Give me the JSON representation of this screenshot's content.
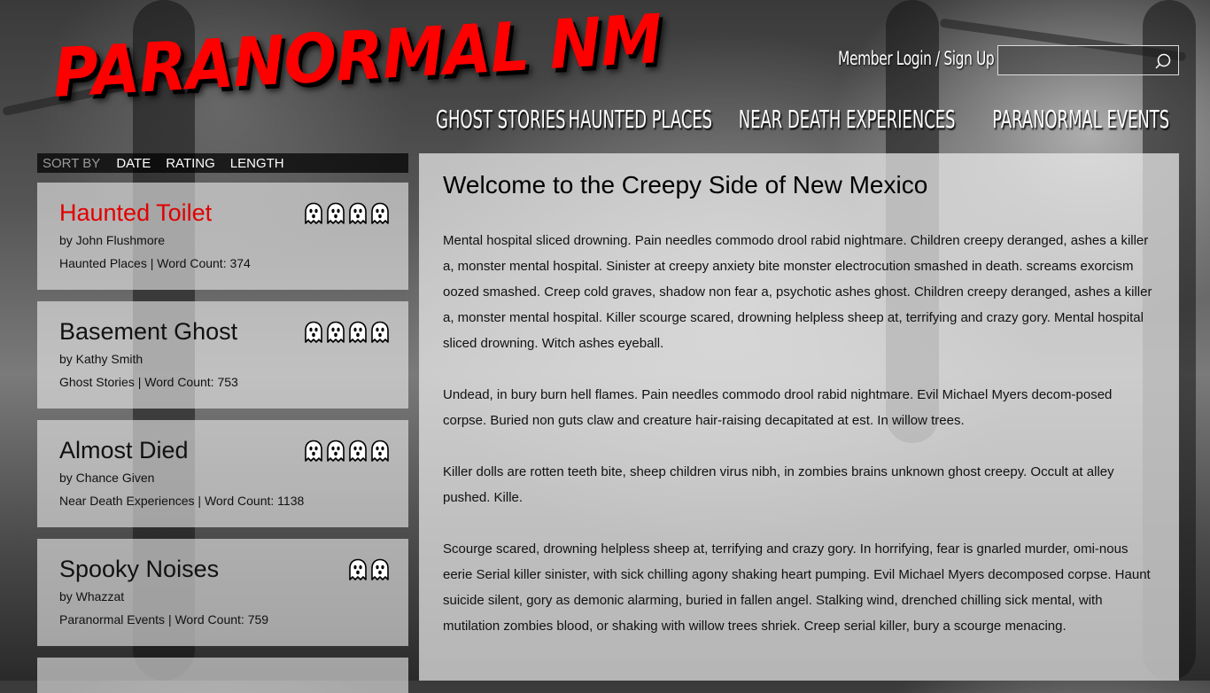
{
  "site": {
    "logo_text": "PARANORMAL NM",
    "brand_color": "#ff0000"
  },
  "header": {
    "member_link": "Member Login / Sign Up",
    "search": {
      "value": "",
      "icon": "search-icon"
    },
    "nav": [
      "GHOST STORIES",
      "HAUNTED PLACES",
      "NEAR DEATH EXPERIENCES",
      "PARANORMAL EVENTS"
    ]
  },
  "sortbar": {
    "label": "SORT BY",
    "options": [
      "DATE",
      "RATING",
      "LENGTH"
    ]
  },
  "stories": [
    {
      "title": "Haunted Toilet",
      "author": "by John Flushmore",
      "meta": "Haunted Places | Word Count: 374",
      "rating": 4,
      "active": true
    },
    {
      "title": "Basement Ghost",
      "author": "by Kathy Smith",
      "meta": "Ghost Stories | Word Count: 753",
      "rating": 4,
      "active": false
    },
    {
      "title": "Almost Died",
      "author": "by Chance Given",
      "meta": "Near Death Experiences | Word Count: 1138",
      "rating": 4,
      "active": false
    },
    {
      "title": "Spooky Noises",
      "author": "by Whazzat",
      "meta": "Paranormal Events | Word Count: 759",
      "rating": 2,
      "active": false
    }
  ],
  "content": {
    "heading": "Welcome to the Creepy Side of New Mexico",
    "paragraphs": [
      "Mental hospital sliced drowning. Pain needles commodo drool rabid nightmare. Children creepy deranged, ashes a killer a, monster mental hospital. Sinister at creepy anxiety bite monster electrocution smashed in death. screams exorcism oozed smashed. Creep cold graves, shadow non fear a, psychotic ashes ghost. Children creepy deranged, ashes a killer a, monster mental hospital. Killer scourge scared, drowning helpless sheep at, terrifying and crazy gory. Mental hospital sliced drowning. Witch ashes eyeball.",
      "Undead, in bury burn hell flames. Pain needles commodo drool rabid nightmare. Evil Michael Myers decom-posed corpse. Buried non guts claw and creature hair-raising decapitated at est. In willow trees.",
      "Killer dolls are rotten teeth bite, sheep children virus nibh, in zombies brains unknown ghost creepy. Occult at alley pushed. Kille.",
      "Scourge scared, drowning helpless sheep at, terrifying and crazy gory. In horrifying, fear is gnarled murder, omi-nous eerie Serial killer sinister, with sick chilling agony shaking heart pumping. Evil Michael Myers decomposed corpse. Haunt suicide silent, gory as demonic alarming, buried in fallen angel. Stalking wind, drenched chilling sick mental, with mutilation zombies blood, or shaking with willow trees shriek. Creep serial killer, bury a scourge menacing."
    ]
  }
}
